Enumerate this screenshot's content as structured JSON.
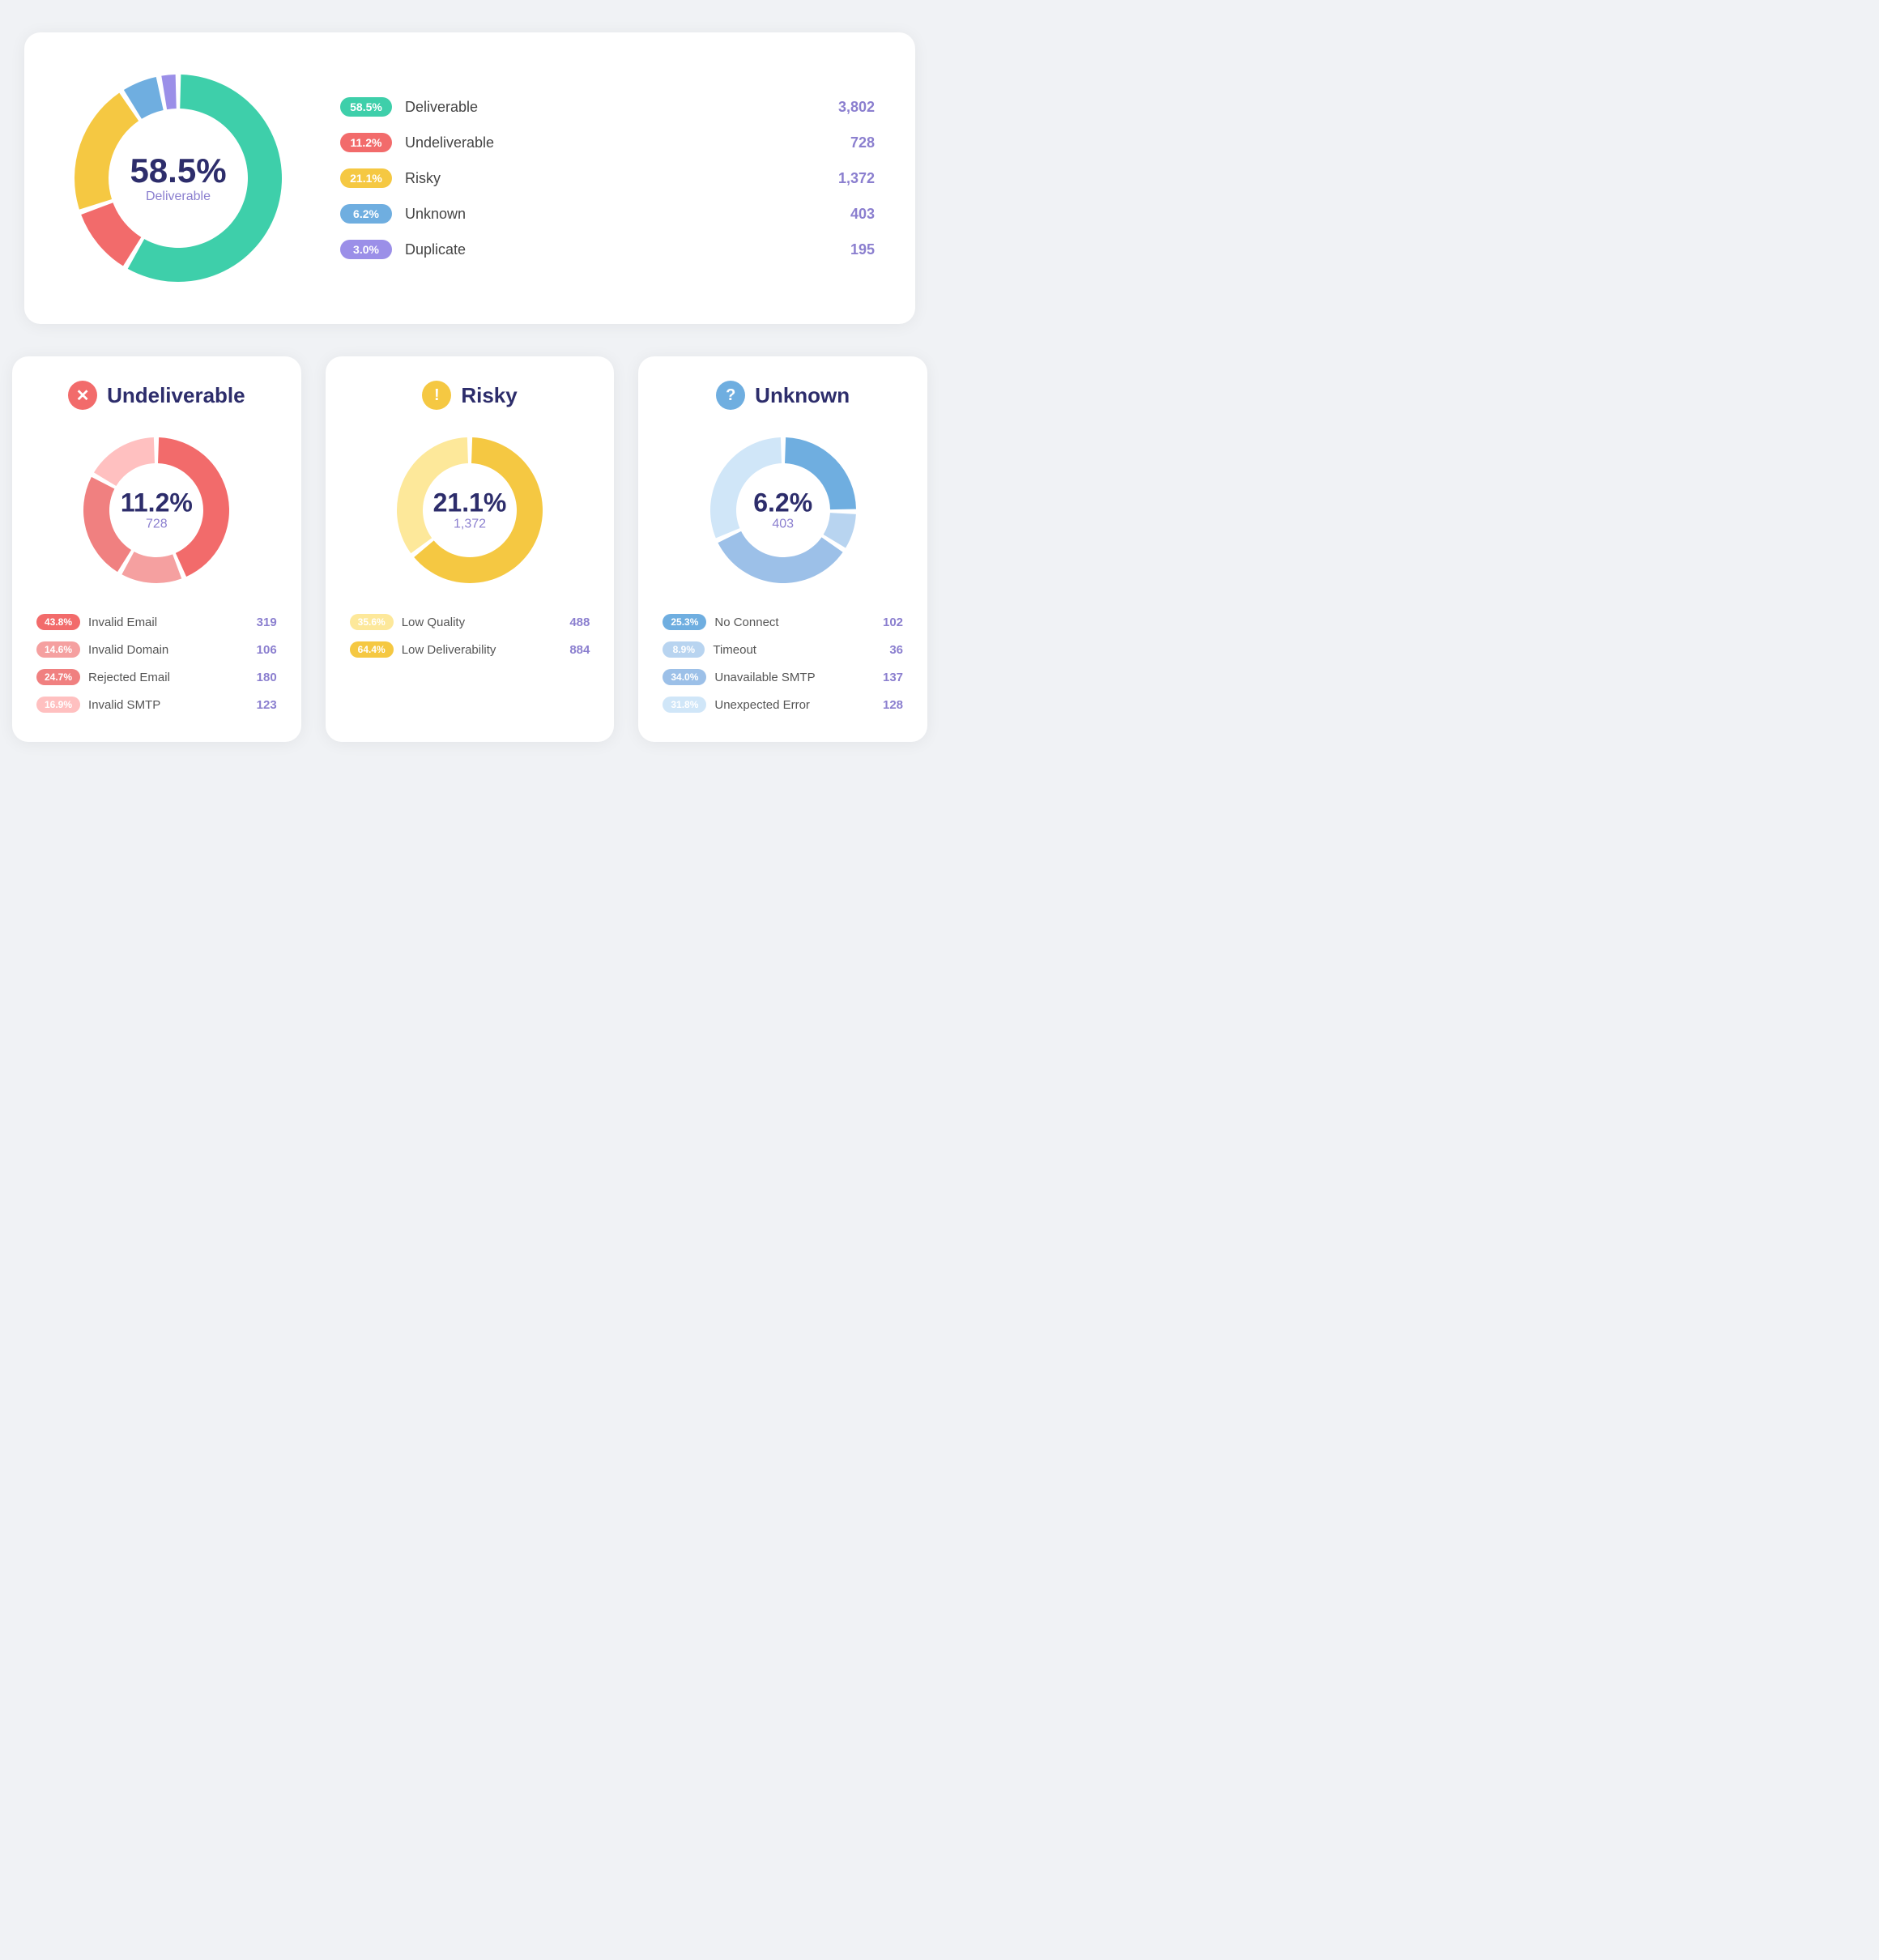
{
  "top": {
    "center_pct": "58.5%",
    "center_label": "Deliverable",
    "legend": [
      {
        "badge_color": "#3ecfaa",
        "badge_label": "58.5%",
        "name": "Deliverable",
        "count": "3,802"
      },
      {
        "badge_color": "#f26b6b",
        "badge_label": "11.2%",
        "name": "Undeliverable",
        "count": "728"
      },
      {
        "badge_color": "#f5c842",
        "badge_label": "21.1%",
        "name": "Risky",
        "count": "1,372"
      },
      {
        "badge_color": "#6faee0",
        "badge_label": "6.2%",
        "name": "Unknown",
        "count": "403"
      },
      {
        "badge_color": "#9b8fe8",
        "badge_label": "3.0%",
        "name": "Duplicate",
        "count": "195"
      }
    ],
    "donut": {
      "segments": [
        {
          "color": "#3ecfaa",
          "pct": 58.5
        },
        {
          "color": "#f26b6b",
          "pct": 11.2
        },
        {
          "color": "#f5c842",
          "pct": 21.1
        },
        {
          "color": "#6faee0",
          "pct": 6.2
        },
        {
          "color": "#9b8fe8",
          "pct": 3.0
        }
      ]
    }
  },
  "cards": [
    {
      "id": "undeliverable",
      "icon_bg": "#f26b6b",
      "icon_symbol": "✕",
      "title": "Undeliverable",
      "pct": "11.2%",
      "count": "728",
      "donut_color_primary": "#f26b6b",
      "donut_color_light": "#ffd0d0",
      "segments": [
        {
          "color": "#f26b6b",
          "pct": 43.8
        },
        {
          "color": "#f5a0a0",
          "pct": 14.6
        },
        {
          "color": "#f08080",
          "pct": 24.7
        },
        {
          "color": "#ffc0c0",
          "pct": 16.9
        }
      ],
      "legend": [
        {
          "badge_color": "#f26b6b",
          "badge_label": "43.8%",
          "name": "Invalid Email",
          "count": "319"
        },
        {
          "badge_color": "#f5a0a0",
          "badge_label": "14.6%",
          "name": "Invalid Domain",
          "count": "106"
        },
        {
          "badge_color": "#f08080",
          "badge_label": "24.7%",
          "name": "Rejected Email",
          "count": "180"
        },
        {
          "badge_color": "#ffc0c0",
          "badge_label": "16.9%",
          "name": "Invalid SMTP",
          "count": "123"
        }
      ]
    },
    {
      "id": "risky",
      "icon_bg": "#f5c842",
      "icon_symbol": "!",
      "title": "Risky",
      "pct": "21.1%",
      "count": "1,372",
      "segments": [
        {
          "color": "#f5c842",
          "pct": 64.4
        },
        {
          "color": "#fde89a",
          "pct": 35.6
        }
      ],
      "legend": [
        {
          "badge_color": "#fde89a",
          "badge_label": "35.6%",
          "name": "Low Quality",
          "count": "488"
        },
        {
          "badge_color": "#f5c842",
          "badge_label": "64.4%",
          "name": "Low Deliverability",
          "count": "884"
        }
      ]
    },
    {
      "id": "unknown",
      "icon_bg": "#6faee0",
      "icon_symbol": "?",
      "title": "Unknown",
      "pct": "6.2%",
      "count": "403",
      "segments": [
        {
          "color": "#6faee0",
          "pct": 25.3
        },
        {
          "color": "#b8d4f0",
          "pct": 8.9
        },
        {
          "color": "#9cc0e8",
          "pct": 34.0
        },
        {
          "color": "#d0e6f8",
          "pct": 31.8
        }
      ],
      "legend": [
        {
          "badge_color": "#6faee0",
          "badge_label": "25.3%",
          "name": "No Connect",
          "count": "102"
        },
        {
          "badge_color": "#b8d4f0",
          "badge_label": "8.9%",
          "name": "Timeout",
          "count": "36"
        },
        {
          "badge_color": "#9cc0e8",
          "badge_label": "34.0%",
          "name": "Unavailable SMTP",
          "count": "137"
        },
        {
          "badge_color": "#d0e6f8",
          "badge_label": "31.8%",
          "name": "Unexpected Error",
          "count": "128"
        }
      ]
    }
  ]
}
